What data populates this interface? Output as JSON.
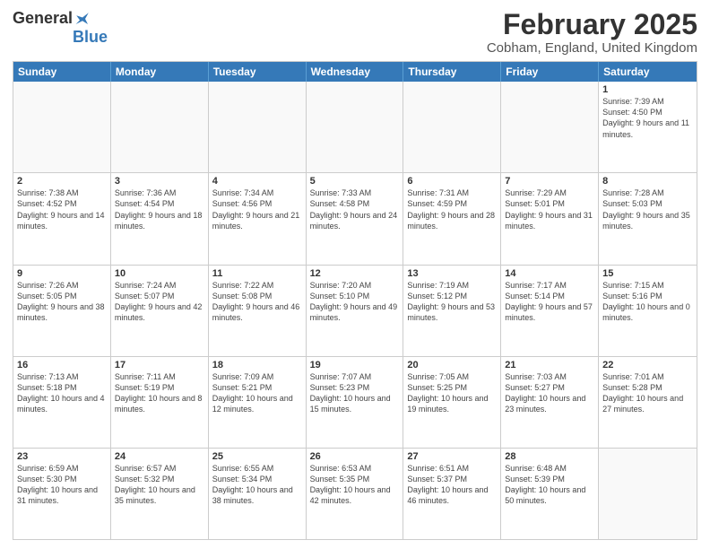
{
  "header": {
    "logo_general": "General",
    "logo_blue": "Blue",
    "month_year": "February 2025",
    "location": "Cobham, England, United Kingdom"
  },
  "days_of_week": [
    "Sunday",
    "Monday",
    "Tuesday",
    "Wednesday",
    "Thursday",
    "Friday",
    "Saturday"
  ],
  "weeks": [
    [
      {
        "day": "",
        "info": ""
      },
      {
        "day": "",
        "info": ""
      },
      {
        "day": "",
        "info": ""
      },
      {
        "day": "",
        "info": ""
      },
      {
        "day": "",
        "info": ""
      },
      {
        "day": "",
        "info": ""
      },
      {
        "day": "1",
        "info": "Sunrise: 7:39 AM\nSunset: 4:50 PM\nDaylight: 9 hours and 11 minutes."
      }
    ],
    [
      {
        "day": "2",
        "info": "Sunrise: 7:38 AM\nSunset: 4:52 PM\nDaylight: 9 hours and 14 minutes."
      },
      {
        "day": "3",
        "info": "Sunrise: 7:36 AM\nSunset: 4:54 PM\nDaylight: 9 hours and 18 minutes."
      },
      {
        "day": "4",
        "info": "Sunrise: 7:34 AM\nSunset: 4:56 PM\nDaylight: 9 hours and 21 minutes."
      },
      {
        "day": "5",
        "info": "Sunrise: 7:33 AM\nSunset: 4:58 PM\nDaylight: 9 hours and 24 minutes."
      },
      {
        "day": "6",
        "info": "Sunrise: 7:31 AM\nSunset: 4:59 PM\nDaylight: 9 hours and 28 minutes."
      },
      {
        "day": "7",
        "info": "Sunrise: 7:29 AM\nSunset: 5:01 PM\nDaylight: 9 hours and 31 minutes."
      },
      {
        "day": "8",
        "info": "Sunrise: 7:28 AM\nSunset: 5:03 PM\nDaylight: 9 hours and 35 minutes."
      }
    ],
    [
      {
        "day": "9",
        "info": "Sunrise: 7:26 AM\nSunset: 5:05 PM\nDaylight: 9 hours and 38 minutes."
      },
      {
        "day": "10",
        "info": "Sunrise: 7:24 AM\nSunset: 5:07 PM\nDaylight: 9 hours and 42 minutes."
      },
      {
        "day": "11",
        "info": "Sunrise: 7:22 AM\nSunset: 5:08 PM\nDaylight: 9 hours and 46 minutes."
      },
      {
        "day": "12",
        "info": "Sunrise: 7:20 AM\nSunset: 5:10 PM\nDaylight: 9 hours and 49 minutes."
      },
      {
        "day": "13",
        "info": "Sunrise: 7:19 AM\nSunset: 5:12 PM\nDaylight: 9 hours and 53 minutes."
      },
      {
        "day": "14",
        "info": "Sunrise: 7:17 AM\nSunset: 5:14 PM\nDaylight: 9 hours and 57 minutes."
      },
      {
        "day": "15",
        "info": "Sunrise: 7:15 AM\nSunset: 5:16 PM\nDaylight: 10 hours and 0 minutes."
      }
    ],
    [
      {
        "day": "16",
        "info": "Sunrise: 7:13 AM\nSunset: 5:18 PM\nDaylight: 10 hours and 4 minutes."
      },
      {
        "day": "17",
        "info": "Sunrise: 7:11 AM\nSunset: 5:19 PM\nDaylight: 10 hours and 8 minutes."
      },
      {
        "day": "18",
        "info": "Sunrise: 7:09 AM\nSunset: 5:21 PM\nDaylight: 10 hours and 12 minutes."
      },
      {
        "day": "19",
        "info": "Sunrise: 7:07 AM\nSunset: 5:23 PM\nDaylight: 10 hours and 15 minutes."
      },
      {
        "day": "20",
        "info": "Sunrise: 7:05 AM\nSunset: 5:25 PM\nDaylight: 10 hours and 19 minutes."
      },
      {
        "day": "21",
        "info": "Sunrise: 7:03 AM\nSunset: 5:27 PM\nDaylight: 10 hours and 23 minutes."
      },
      {
        "day": "22",
        "info": "Sunrise: 7:01 AM\nSunset: 5:28 PM\nDaylight: 10 hours and 27 minutes."
      }
    ],
    [
      {
        "day": "23",
        "info": "Sunrise: 6:59 AM\nSunset: 5:30 PM\nDaylight: 10 hours and 31 minutes."
      },
      {
        "day": "24",
        "info": "Sunrise: 6:57 AM\nSunset: 5:32 PM\nDaylight: 10 hours and 35 minutes."
      },
      {
        "day": "25",
        "info": "Sunrise: 6:55 AM\nSunset: 5:34 PM\nDaylight: 10 hours and 38 minutes."
      },
      {
        "day": "26",
        "info": "Sunrise: 6:53 AM\nSunset: 5:35 PM\nDaylight: 10 hours and 42 minutes."
      },
      {
        "day": "27",
        "info": "Sunrise: 6:51 AM\nSunset: 5:37 PM\nDaylight: 10 hours and 46 minutes."
      },
      {
        "day": "28",
        "info": "Sunrise: 6:48 AM\nSunset: 5:39 PM\nDaylight: 10 hours and 50 minutes."
      },
      {
        "day": "",
        "info": ""
      }
    ]
  ]
}
